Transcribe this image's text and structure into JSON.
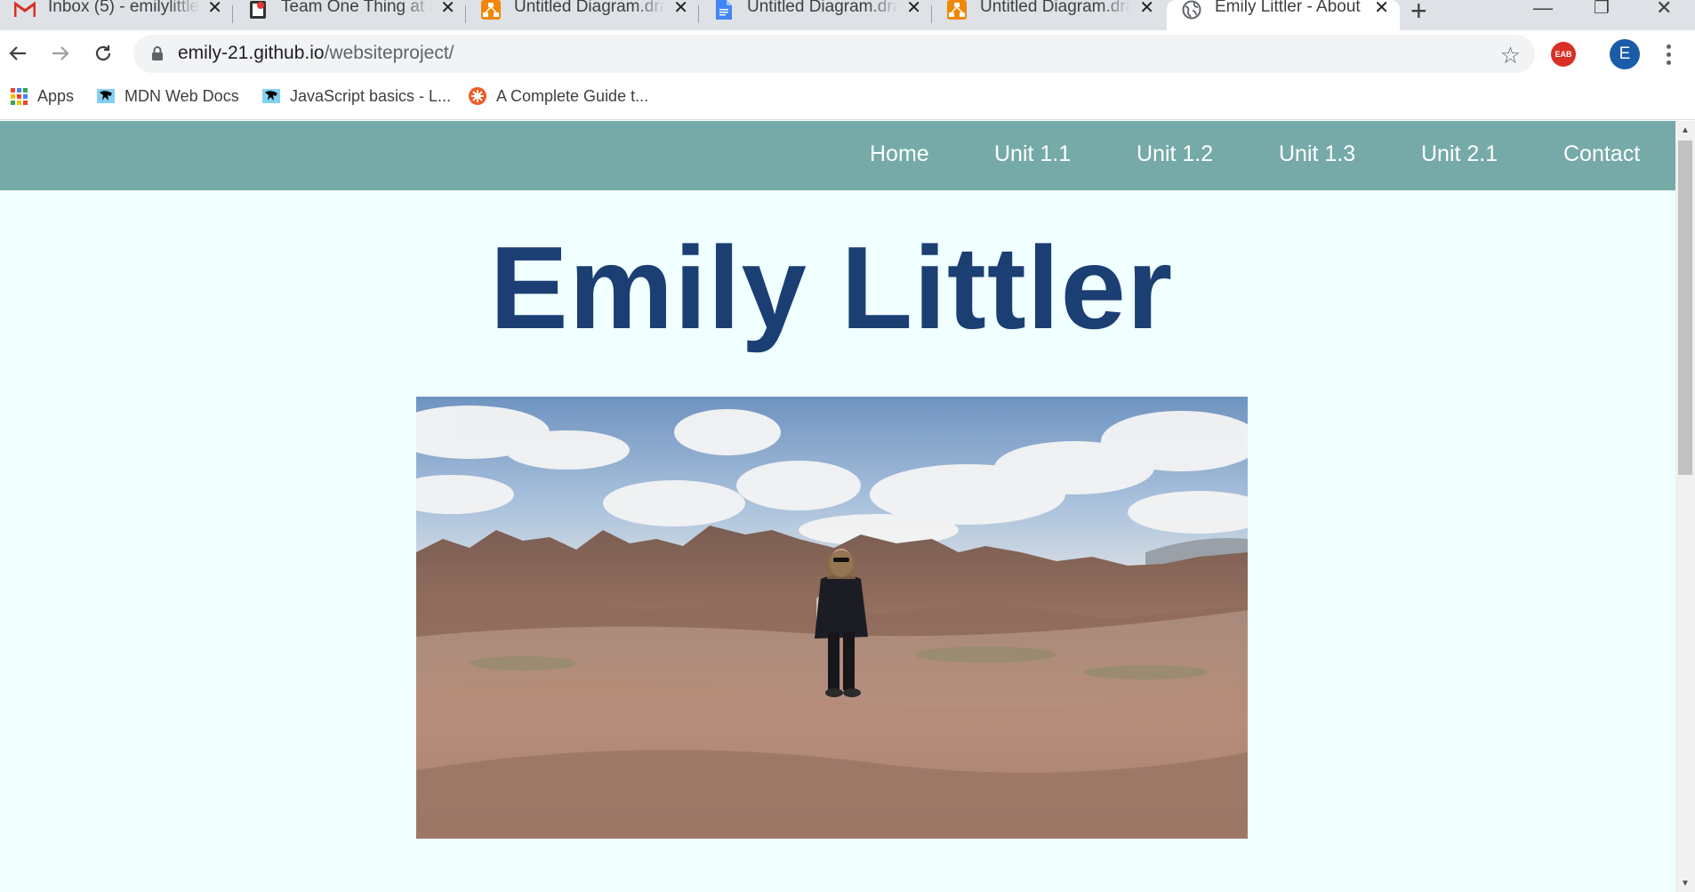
{
  "browser": {
    "tabs": [
      {
        "title": "Inbox (5) - emilylittle",
        "favicon": "gmail-icon",
        "active": false
      },
      {
        "title": "Team One Thing at a",
        "favicon": "doc-app-icon",
        "active": false
      },
      {
        "title": "Untitled Diagram.dra",
        "favicon": "drawio-icon",
        "active": false
      },
      {
        "title": "Untitled Diagram.dra",
        "favicon": "google-doc-icon",
        "active": false
      },
      {
        "title": "Untitled Diagram.dra",
        "favicon": "drawio-icon",
        "active": false
      },
      {
        "title": "Emily Littler - About",
        "favicon": "globe-icon",
        "active": true
      }
    ],
    "new_tab_glyph": "+",
    "window_controls": {
      "minimize": "—",
      "maximize": "❐",
      "close": "✕"
    },
    "address_bar": {
      "domain": "emily-21.github.io",
      "path": "/websiteproject/"
    },
    "extension_label": "EAB",
    "profile_initial": "E",
    "bookmarks": [
      {
        "label": "Apps",
        "icon": "apps-grid-icon"
      },
      {
        "label": "MDN Web Docs",
        "icon": "mdn-icon"
      },
      {
        "label": "JavaScript basics - L...",
        "icon": "mdn-icon"
      },
      {
        "label": "A Complete Guide t...",
        "icon": "css-tricks-icon"
      }
    ]
  },
  "site": {
    "nav": [
      "Home",
      "Unit 1.1",
      "Unit 1.2",
      "Unit 1.3",
      "Unit 2.1",
      "Contact"
    ],
    "heading": "Emily Littler",
    "colors": {
      "nav_bg": "#75aaa9",
      "page_bg": "#f0ffff",
      "heading": "#1b3f73"
    }
  }
}
